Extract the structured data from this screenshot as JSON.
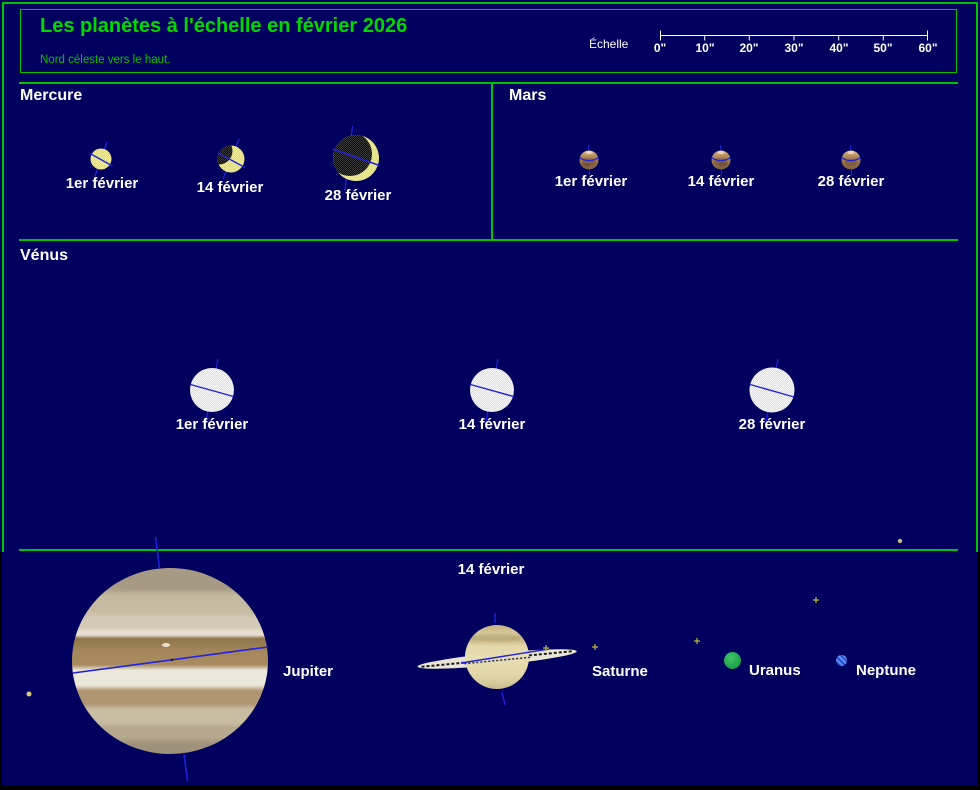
{
  "header": {
    "title": "Les planètes à l'échelle en février 2026",
    "subtitle": "Nord céleste vers le haut."
  },
  "scale_bar": {
    "label": "Échelle",
    "ticks": [
      "0\"",
      "10\"",
      "20\"",
      "30\"",
      "40\"",
      "50\"",
      "60\""
    ]
  },
  "panels": {
    "mercury": {
      "title": "Mercure",
      "dates": [
        "1er février",
        "14 février",
        "28 février"
      ]
    },
    "mars": {
      "title": "Mars",
      "dates": [
        "1er février",
        "14 février",
        "28 février"
      ]
    },
    "venus": {
      "title": "Vénus",
      "dates": [
        "1er février",
        "14 février",
        "28 février"
      ]
    },
    "outer_planets": {
      "date": "14 février",
      "labels": {
        "jupiter": "Jupiter",
        "saturn": "Saturne",
        "uranus": "Uranus",
        "neptune": "Neptune"
      }
    }
  },
  "colors": {
    "background": "#00005e",
    "frame_green": "#00c400",
    "title_green": "#00d800",
    "text_white": "#ffffff",
    "ecliptic_blue": "#2222dd",
    "mercury_yellow": "#e7e383",
    "mercury_dark": "#2e2e2e",
    "mars_tan": "#b3885f",
    "venus_gray": "#ececec",
    "jupiter_belt_brown": "#9e8155",
    "saturn_cream": "#e2d8ab",
    "uranus_green": "#27b351",
    "neptune_blue": "#3f6fe0",
    "moon_mark_yellow": "#b8b83a",
    "star_dot_tan": "#c9b87e"
  }
}
